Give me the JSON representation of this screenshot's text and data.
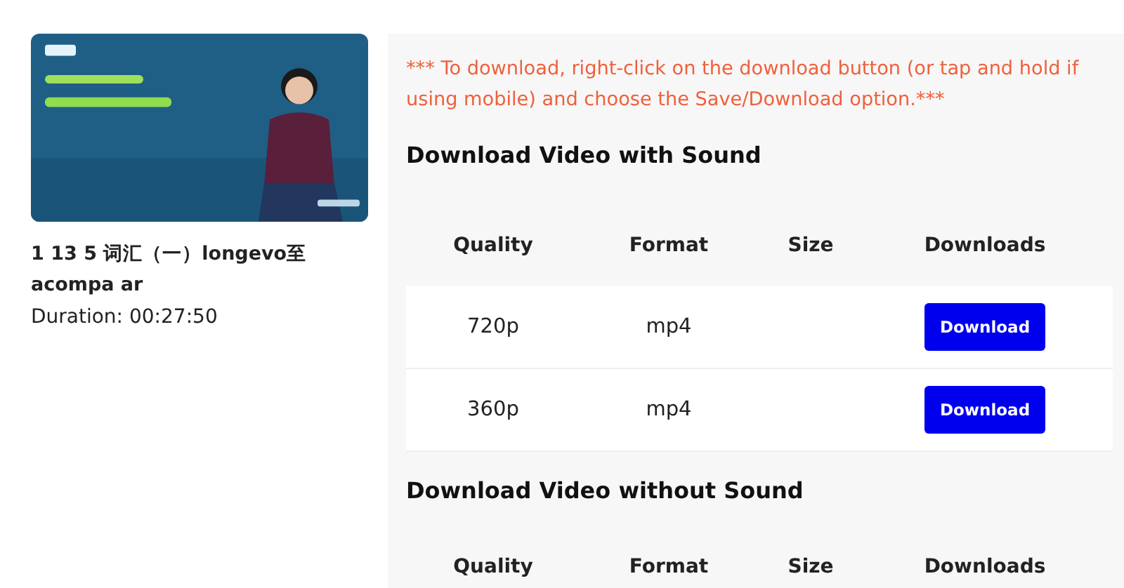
{
  "video": {
    "title": "1 13 5 词汇（一）longevo至 acompa ar",
    "duration": "Duration: 00:27:50"
  },
  "notice": "*** To download, right-click on the download button (or tap and hold if using mobile) and choose the Save/Download option.***",
  "sections": [
    {
      "title": "Download Video with Sound",
      "columns": [
        "Quality",
        "Format",
        "Size",
        "Downloads"
      ],
      "rows": [
        {
          "quality": "720p",
          "format": "mp4",
          "button": "Download"
        },
        {
          "quality": "360p",
          "format": "mp4",
          "button": "Download"
        }
      ]
    },
    {
      "title": "Download Video without Sound",
      "columns": [
        "Quality",
        "Format",
        "Size",
        "Downloads"
      ]
    }
  ]
}
